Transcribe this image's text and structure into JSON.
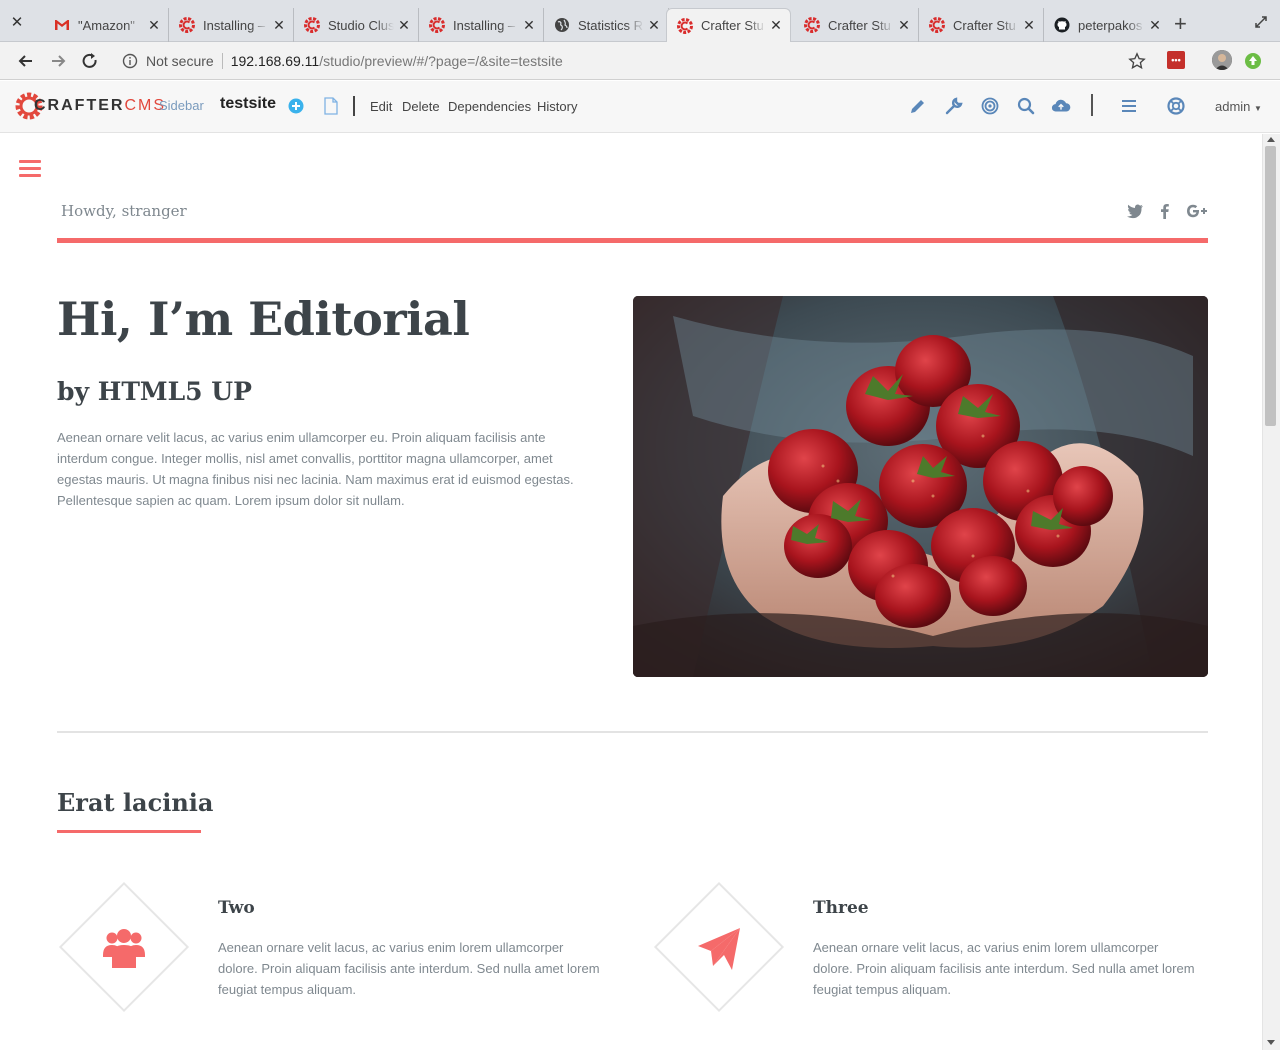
{
  "browser": {
    "tabs": [
      {
        "title": "\"Amazon\"",
        "favicon": "gmail-icon"
      },
      {
        "title": "Installing –",
        "favicon": "crafter-icon"
      },
      {
        "title": "Studio Clus",
        "favicon": "crafter-icon"
      },
      {
        "title": "Installing –",
        "favicon": "crafter-icon"
      },
      {
        "title": "Statistics R",
        "favicon": "globe-icon"
      },
      {
        "title": "Crafter Stu",
        "favicon": "crafter-icon",
        "active": true
      },
      {
        "title": "Crafter Stu",
        "favicon": "crafter-icon"
      },
      {
        "title": "Crafter Stu",
        "favicon": "crafter-icon"
      },
      {
        "title": "peterpakos",
        "favicon": "github-icon"
      }
    ],
    "address": {
      "security": "Not secure",
      "host": "192.168.69.11",
      "path": "/studio/preview/#/?page=/&site=testsite"
    }
  },
  "crafter": {
    "logo_main": "CRAFTER",
    "logo_cms": "CMS",
    "sidebar_label": "Sidebar",
    "site_name": "testsite",
    "actions": [
      "Edit",
      "Delete",
      "Dependencies",
      "History"
    ],
    "user": "admin",
    "accent_color": "#e2483d"
  },
  "page": {
    "greeting": "Howdy, stranger",
    "hero": {
      "title": "Hi, I’m Editorial",
      "subtitle": "by HTML5 UP",
      "body": "Aenean ornare velit lacus, ac varius enim ullamcorper eu. Proin aliquam facilisis ante interdum congue. Integer mollis, nisl amet convallis, porttitor magna ullamcorper, amet egestas mauris. Ut magna finibus nisi nec lacinia. Nam maximus erat id euismod egestas. Pellentesque sapien ac quam. Lorem ipsum dolor sit nullam."
    },
    "section_title": "Erat lacinia",
    "features": [
      {
        "title": "Two",
        "icon": "users-icon",
        "text": "Aenean ornare velit lacus, ac varius enim lorem ullamcorper dolore. Proin aliquam facilisis ante interdum. Sed nulla amet lorem feugiat tempus aliquam."
      },
      {
        "title": "Three",
        "icon": "paper-plane-icon",
        "text": "Aenean ornare velit lacus, ac varius enim lorem ullamcorper dolore. Proin aliquam facilisis ante interdum. Sed nulla amet lorem feugiat tempus aliquam."
      }
    ],
    "accent_color": "#f56a6a"
  }
}
